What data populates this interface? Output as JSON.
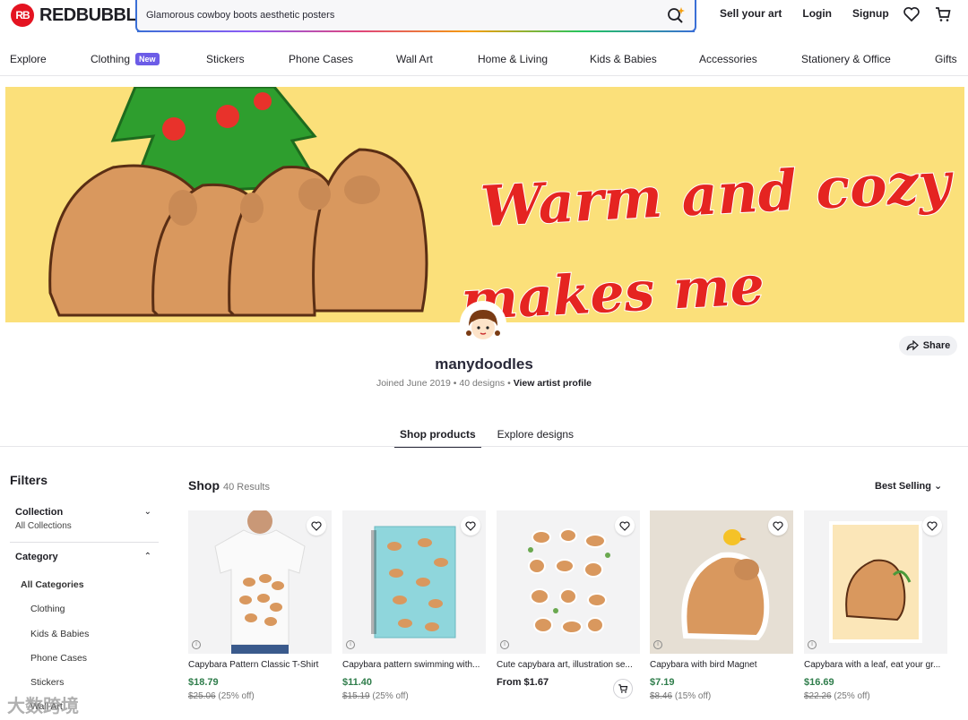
{
  "brand": {
    "name": "REDBUBBLE",
    "mark": "RB",
    "color": "#e41321"
  },
  "search": {
    "value": "Glamorous cowboy boots aesthetic posters"
  },
  "header_links": {
    "sell": "Sell your art",
    "login": "Login",
    "signup": "Signup"
  },
  "nav": {
    "items": [
      "Explore",
      "Clothing",
      "Stickers",
      "Phone Cases",
      "Wall Art",
      "Home & Living",
      "Kids & Babies",
      "Accessories",
      "Stationery & Office",
      "Gifts"
    ],
    "new_badge": "New"
  },
  "banner": {
    "line1": "Warm and cozy",
    "line2": "makes me cappy!",
    "bg": "#fbe07a",
    "text_color": "#e52421"
  },
  "artist": {
    "name": "manydoodles",
    "joined": "Joined June 2019",
    "designs": "40 designs",
    "profile_link": "View artist profile",
    "share": "Share"
  },
  "tabs": {
    "shop": "Shop products",
    "explore": "Explore designs"
  },
  "filters": {
    "title": "Filters",
    "collection_label": "Collection",
    "collection_value": "All Collections",
    "category_label": "Category",
    "categories": [
      "All Categories",
      "Clothing",
      "Kids & Babies",
      "Phone Cases",
      "Stickers",
      "Wall Art"
    ]
  },
  "shop": {
    "title": "Shop",
    "count": "40 Results",
    "sort": "Best Selling"
  },
  "products": [
    {
      "title": "Capybara Pattern Classic T-Shirt",
      "price": "$18.79",
      "old": "$25.06",
      "off": "(25% off)"
    },
    {
      "title": "Capybara pattern swimming with...",
      "price": "$11.40",
      "old": "$15.19",
      "off": "(25% off)"
    },
    {
      "title": "Cute capybara art, illustration se...",
      "price": "From $1.67",
      "old": "",
      "off": ""
    },
    {
      "title": "Capybara with bird Magnet",
      "price": "$7.19",
      "old": "$8.46",
      "off": "(15% off)"
    },
    {
      "title": "Capybara with a leaf, eat your gr...",
      "price": "$16.69",
      "old": "$22.26",
      "off": "(25% off)"
    }
  ],
  "watermark": "大数跨境"
}
